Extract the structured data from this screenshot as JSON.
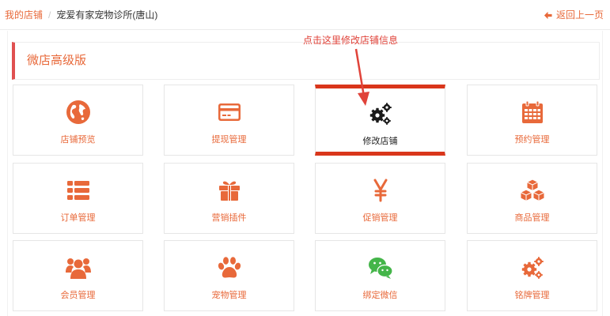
{
  "breadcrumb": {
    "root": "我的店铺",
    "separator": "/",
    "current": "宠爱有家宠物诊所(唐山)"
  },
  "back_link": "返回上一页",
  "section": {
    "title": "微店高级版"
  },
  "annotation": "点击这里修改店铺信息",
  "colors": {
    "accent": "#e8693a",
    "header_bar": "#e05050",
    "highlight_border": "#d9361b",
    "annotation": "#e0433a"
  },
  "tiles": [
    {
      "label": "店铺预览",
      "icon": "globe-icon"
    },
    {
      "label": "提现管理",
      "icon": "credit-card-icon"
    },
    {
      "label": "修改店铺",
      "icon": "gears-icon"
    },
    {
      "label": "预约管理",
      "icon": "calendar-icon"
    },
    {
      "label": "订单管理",
      "icon": "list-icon"
    },
    {
      "label": "营销插件",
      "icon": "gift-icon"
    },
    {
      "label": "促销管理",
      "icon": "yen-icon"
    },
    {
      "label": "商品管理",
      "icon": "cubes-icon"
    },
    {
      "label": "会员管理",
      "icon": "users-icon"
    },
    {
      "label": "宠物管理",
      "icon": "paw-icon"
    },
    {
      "label": "绑定微信",
      "icon": "wechat-icon"
    },
    {
      "label": "铭牌管理",
      "icon": "gears-icon"
    }
  ]
}
